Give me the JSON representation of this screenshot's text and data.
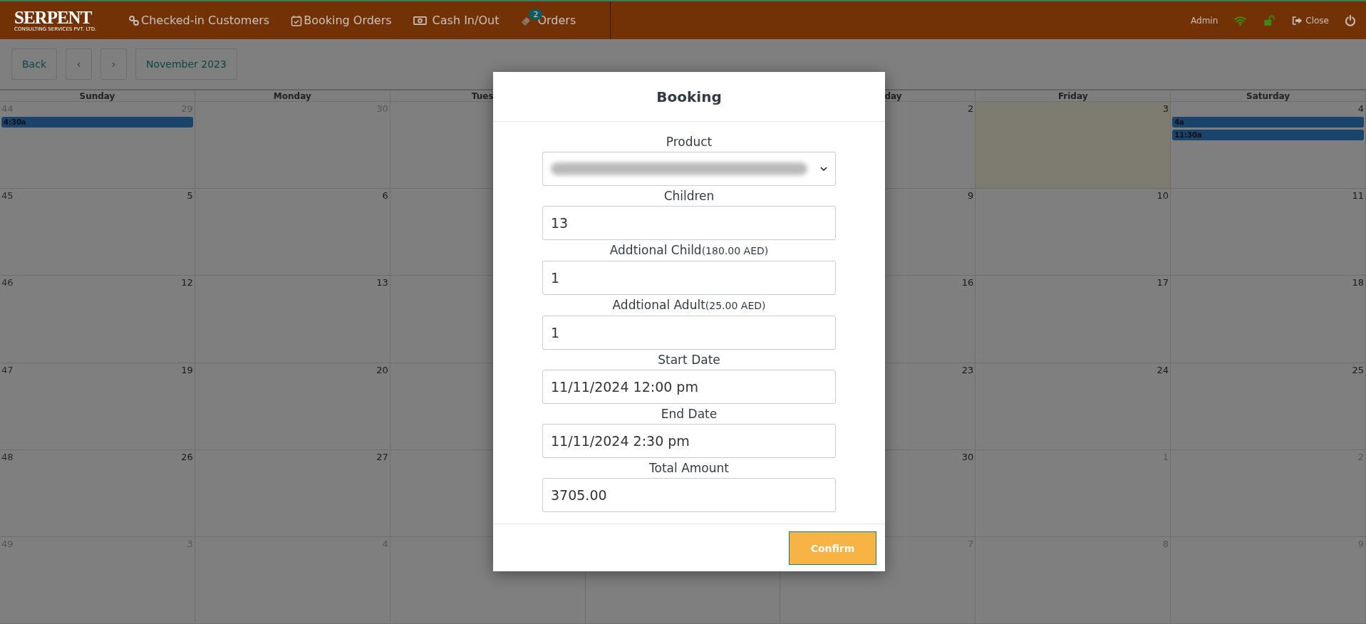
{
  "topbar": {
    "logo": {
      "name": "SERPENT",
      "tagline": "CONSULTING SERVICES PVT. LTD."
    },
    "nav": [
      {
        "kind": "link",
        "label": "Checked-in Customers"
      },
      {
        "kind": "calendar",
        "label": "Booking Orders"
      },
      {
        "kind": "money",
        "label": "Cash In/Out"
      },
      {
        "kind": "tag",
        "label": "Orders",
        "badge": "2"
      }
    ],
    "user": "Admin",
    "close": "Close"
  },
  "toolbar": {
    "back": "Back",
    "prev": "‹",
    "next": "›",
    "month": "November 2023"
  },
  "calendar": {
    "headers": [
      "Sunday",
      "Monday",
      "Tues",
      "day",
      "Friday",
      "Saturday"
    ],
    "weeks": [
      {
        "number": "44",
        "dimmed": true,
        "days": [
          {
            "day": "29",
            "other_month": true,
            "today": false,
            "events": [
              "4:30a"
            ]
          },
          {
            "day": "30",
            "other_month": true,
            "today": false
          },
          {
            "day": "2",
            "other_month": false,
            "today": false
          },
          {
            "day": "3",
            "other_month": false,
            "today": true
          },
          {
            "day": "4",
            "other_month": false,
            "today": false,
            "events": [
              "4a",
              "11:30a"
            ]
          }
        ]
      },
      {
        "number": "45",
        "dimmed": false,
        "days": [
          {
            "day": "5",
            "other_month": false,
            "today": false
          },
          {
            "day": "6",
            "other_month": false,
            "today": false
          },
          {
            "day": "9",
            "other_month": false,
            "today": false
          },
          {
            "day": "10",
            "other_month": false,
            "today": false
          },
          {
            "day": "11",
            "other_month": false,
            "today": false
          }
        ]
      },
      {
        "number": "46",
        "dimmed": false,
        "days": [
          {
            "day": "12",
            "other_month": false,
            "today": false
          },
          {
            "day": "13",
            "other_month": false,
            "today": false
          },
          {
            "day": "16",
            "other_month": false,
            "today": false
          },
          {
            "day": "17",
            "other_month": false,
            "today": false
          },
          {
            "day": "18",
            "other_month": false,
            "today": false
          }
        ]
      },
      {
        "number": "47",
        "dimmed": false,
        "days": [
          {
            "day": "19",
            "other_month": false,
            "today": false
          },
          {
            "day": "20",
            "other_month": false,
            "today": false
          },
          {
            "day": "23",
            "other_month": false,
            "today": false
          },
          {
            "day": "24",
            "other_month": false,
            "today": false
          },
          {
            "day": "25",
            "other_month": false,
            "today": false
          }
        ]
      },
      {
        "number": "48",
        "dimmed": false,
        "days": [
          {
            "day": "26",
            "other_month": false,
            "today": false
          },
          {
            "day": "27",
            "other_month": false,
            "today": false
          },
          {
            "day": "30",
            "other_month": false,
            "today": false
          },
          {
            "day": "1",
            "other_month": true,
            "today": false
          },
          {
            "day": "2",
            "other_month": true,
            "today": false
          }
        ]
      },
      {
        "number": "49",
        "dimmed": true,
        "days": [
          {
            "day": "3",
            "other_month": true,
            "today": false
          },
          {
            "day": "4",
            "other_month": true,
            "today": false
          },
          {
            "day": "7",
            "other_month": true,
            "today": false
          },
          {
            "day": "8",
            "other_month": true,
            "today": false
          },
          {
            "day": "9",
            "other_month": true,
            "today": false
          }
        ]
      }
    ]
  },
  "modal": {
    "title": "Booking",
    "fields": [
      {
        "kind": "select",
        "label": "Product"
      },
      {
        "kind": "text",
        "label": "Children",
        "value": "13"
      },
      {
        "kind": "text",
        "label": "Addtional Child",
        "note": "(180.00 AED)",
        "value": "1"
      },
      {
        "kind": "text",
        "label": "Addtional Adult",
        "note": "(25.00 AED)",
        "value": "1"
      },
      {
        "kind": "text",
        "label": "Start Date",
        "value": "11/11/2024 12:00 pm"
      },
      {
        "kind": "text",
        "label": "End Date",
        "value": "11/11/2024 2:30 pm"
      },
      {
        "kind": "text",
        "label": "Total Amount",
        "value": "3705.00"
      }
    ],
    "confirm": "Confirm"
  }
}
